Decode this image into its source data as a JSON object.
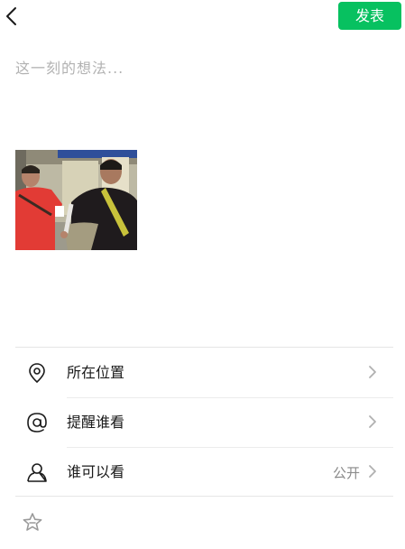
{
  "header": {
    "back_icon": "chevron-left-icon",
    "publish_label": "发表",
    "publish_color": "#07c160"
  },
  "compose": {
    "placeholder": "这一刻的想法..."
  },
  "media": {
    "photo_count": 1
  },
  "options": [
    {
      "icon": "location-pin-icon",
      "label": "所在位置",
      "value": ""
    },
    {
      "icon": "at-sign-icon",
      "label": "提醒谁看",
      "value": ""
    },
    {
      "icon": "person-icon",
      "label": "谁可以看",
      "value": "公开"
    }
  ],
  "footer": {
    "icon": "favorite-star-icon"
  }
}
